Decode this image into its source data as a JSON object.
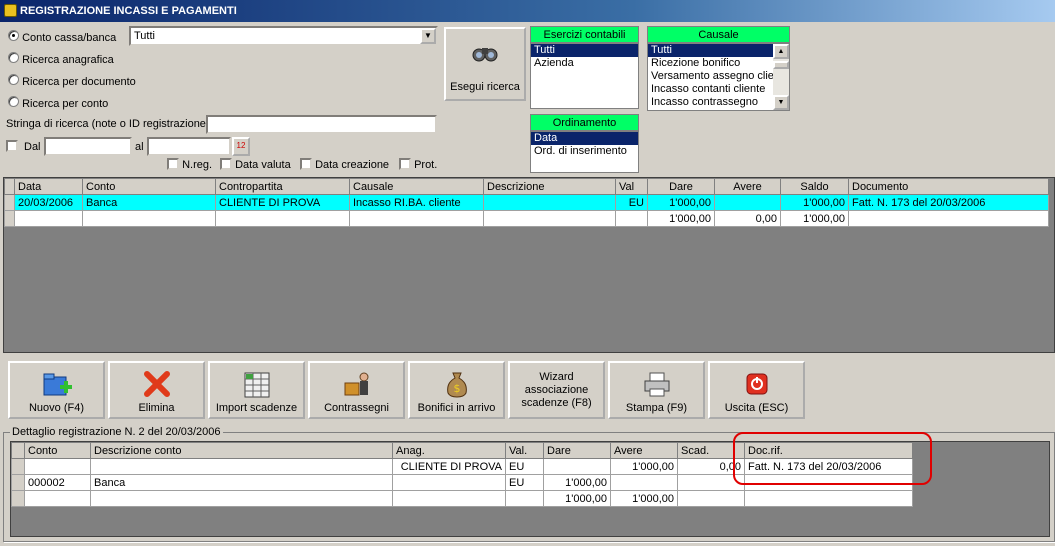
{
  "window": {
    "title": "REGISTRAZIONE INCASSI E PAGAMENTI"
  },
  "search": {
    "radio_cassa": "Conto cassa/banca",
    "cassa_value": "Tutti",
    "radio_anagrafica": "Ricerca anagrafica",
    "radio_documento": "Ricerca per documento",
    "radio_conto": "Ricerca per conto",
    "stringa_label": "Stringa di ricerca (note o ID registrazione)",
    "stringa_value": "",
    "dal_label": "Dal",
    "al_label": "al",
    "nreg_label": "N.reg.",
    "data_valuta_label": "Data valuta",
    "data_creazione_label": "Data creazione",
    "prot_label": "Prot.",
    "esegui_label": "Esegui ricerca"
  },
  "esercizi": {
    "title": "Esercizi contabili",
    "items": [
      "Tutti",
      "Azienda"
    ]
  },
  "ordinamento": {
    "title": "Ordinamento",
    "items": [
      "Data",
      "Ord. di inserimento"
    ]
  },
  "causale": {
    "title": "Causale",
    "items": [
      "Tutti",
      "Ricezione bonifico",
      "Versamento assegno client",
      "Incasso contanti cliente",
      "Incasso contrassegno"
    ]
  },
  "main_table": {
    "headers": [
      "Data",
      "Conto",
      "Contropartita",
      "Causale",
      "Descrizione",
      "Val",
      "Dare",
      "Avere",
      "Saldo",
      "Documento"
    ],
    "rows": [
      [
        "20/03/2006",
        "Banca",
        "CLIENTE DI PROVA",
        "Incasso RI.BA. cliente",
        "",
        "EU",
        "1'000,00",
        "",
        "1'000,00",
        "Fatt. N. 173 del 20/03/2006"
      ],
      [
        "",
        "",
        "",
        "",
        "",
        "",
        "1'000,00",
        "0,00",
        "1'000,00",
        ""
      ]
    ]
  },
  "toolbar": {
    "nuovo": "Nuovo (F4)",
    "elimina": "Elimina",
    "import": "Import scadenze",
    "contrassegni": "Contrassegni",
    "bonifici": "Bonifici in arrivo",
    "wizard": "Wizard associazione scadenze (F8)",
    "stampa": "Stampa (F9)",
    "uscita": "Uscita (ESC)"
  },
  "detail": {
    "title": "Dettaglio registrazione N. 2 del 20/03/2006",
    "headers": [
      "Conto",
      "Descrizione conto",
      "Anag.",
      "Val.",
      "Dare",
      "Avere",
      "Scad.",
      "Doc.rif."
    ],
    "rows": [
      [
        "",
        "",
        "CLIENTE DI PROVA",
        "EU",
        "",
        "1'000,00",
        "0,00",
        "Fatt. N. 173 del 20/03/2006"
      ],
      [
        "000002",
        "Banca",
        "",
        "EU",
        "1'000,00",
        "",
        "",
        ""
      ],
      [
        "",
        "",
        "",
        "",
        "1'000,00",
        "1'000,00",
        "",
        ""
      ]
    ]
  }
}
